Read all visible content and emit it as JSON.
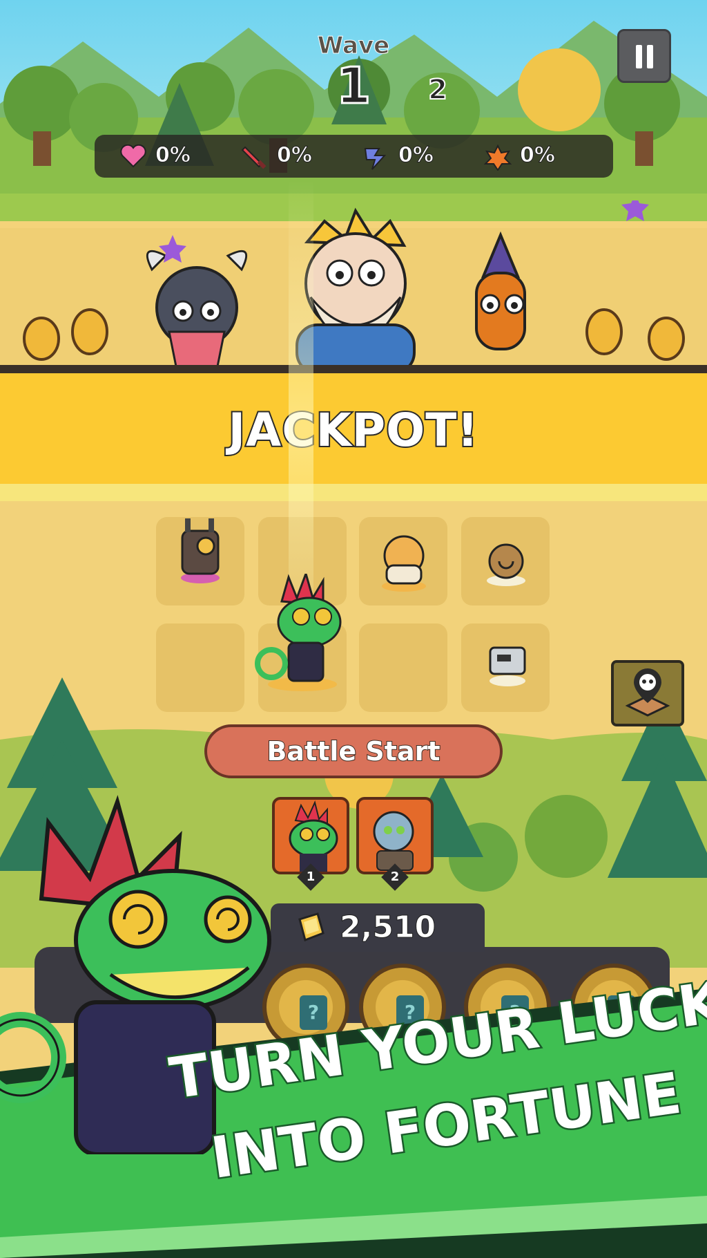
{
  "hud": {
    "wave_label": "Wave",
    "wave_current": "1",
    "wave_next": "2",
    "pause_icon": "pause-icon"
  },
  "stats": [
    {
      "icon": "heart-icon",
      "color": "#f06aa8",
      "value": "0%"
    },
    {
      "icon": "sword-icon",
      "color": "#e4434b",
      "value": "0%"
    },
    {
      "icon": "speed-icon",
      "color": "#6f7fe0",
      "value": "0%"
    },
    {
      "icon": "critical-icon",
      "color": "#f07a2a",
      "value": "0%"
    }
  ],
  "banner": {
    "text": "JACKPOT!",
    "color": "#fcca32"
  },
  "board": {
    "units": [
      {
        "name": "robot-unit",
        "cell": "r1c1"
      },
      {
        "name": "hamster-unit",
        "cell": "r1c3"
      },
      {
        "name": "snail-unit",
        "cell": "r1c4"
      },
      {
        "name": "chameleon-unit",
        "cell": "r2c2"
      },
      {
        "name": "tv-robot-unit",
        "cell": "r2c4"
      }
    ]
  },
  "battle_start_label": "Battle Start",
  "cards": [
    {
      "icon": "chameleon-icon",
      "number": "1"
    },
    {
      "icon": "alien-icon",
      "number": "2"
    }
  ],
  "currency": {
    "icon": "gem-icon",
    "amount": "2,510"
  },
  "promo": {
    "line1": "TURN YOUR LUCK",
    "line2": "INTO FORTUNE",
    "color": "#3fbf52"
  }
}
